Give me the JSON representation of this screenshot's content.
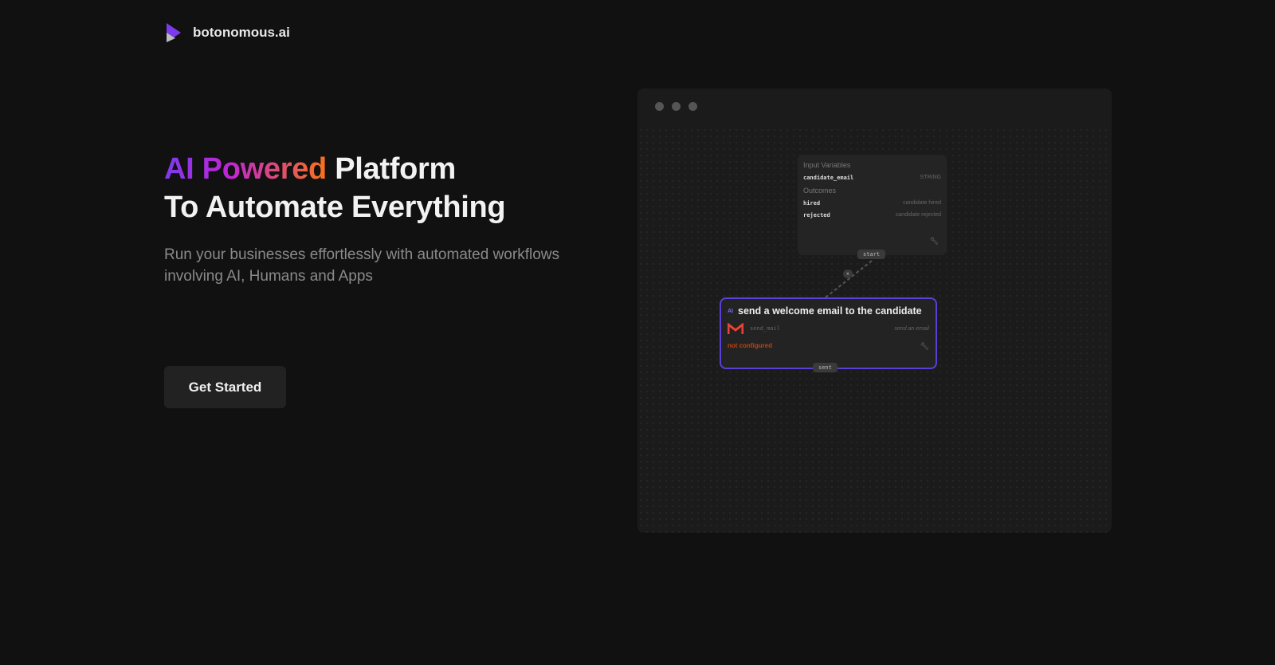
{
  "brand": {
    "name": "botonomous.ai"
  },
  "hero": {
    "highlight": "AI Powered",
    "title_rest": "Platform",
    "title_line2": "To Automate Everything",
    "subtitle": "Run your businesses effortlessly with automated workflows involving AI, Humans and Apps",
    "cta": "Get Started"
  },
  "workflow": {
    "input_card": {
      "input_label": "Input Variables",
      "variables": [
        {
          "name": "candidate_email",
          "type": "STRING"
        }
      ],
      "outcomes_label": "Outcomes",
      "outcomes": [
        {
          "name": "hired",
          "desc": "candidate hired"
        },
        {
          "name": "rejected",
          "desc": "candidate rejected"
        }
      ],
      "port": "start"
    },
    "connector": "x",
    "step_card": {
      "title": "send a welcome email to the candidate",
      "action": "send_mail",
      "action_desc": "send an email",
      "status": "not configured",
      "port": "sent"
    }
  }
}
